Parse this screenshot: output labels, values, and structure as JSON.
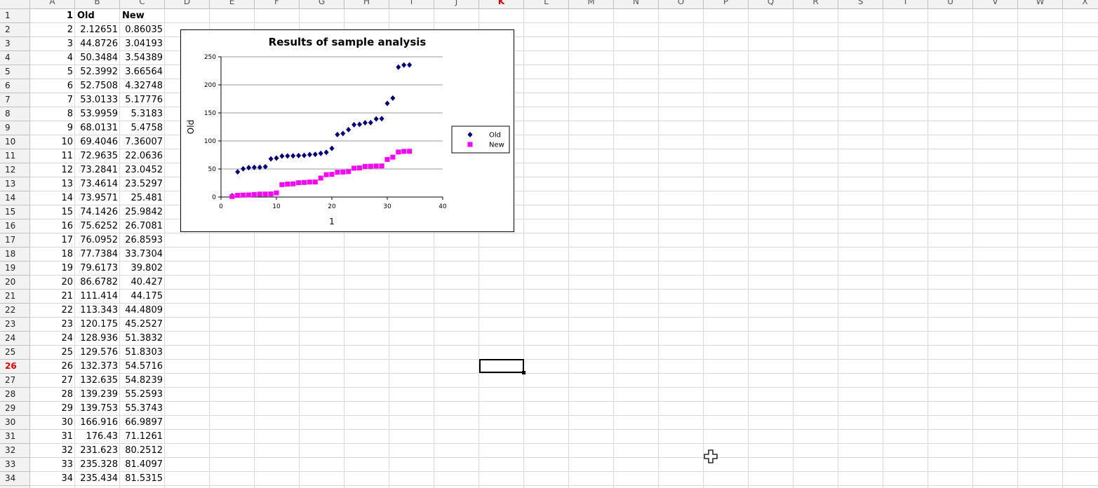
{
  "columns": [
    "A",
    "B",
    "C",
    "D",
    "E",
    "F",
    "G",
    "H",
    "I",
    "J",
    "K",
    "L",
    "M",
    "N",
    "O",
    "P",
    "Q",
    "R",
    "S",
    "T",
    "U",
    "V",
    "W",
    "X"
  ],
  "active_column": "K",
  "active_row": 26,
  "rows": [
    1,
    2,
    3,
    4,
    5,
    6,
    7,
    8,
    9,
    10,
    11,
    12,
    13,
    14,
    15,
    16,
    17,
    18,
    19,
    20,
    21,
    22,
    23,
    24,
    25,
    26,
    27,
    28,
    29,
    30,
    31,
    32,
    33,
    34
  ],
  "table": {
    "headers": {
      "A": "1",
      "B": "Old",
      "C": "New"
    },
    "data": [
      [
        "2",
        "2.12651",
        "0.86035"
      ],
      [
        "3",
        "44.8726",
        "3.04193"
      ],
      [
        "4",
        "50.3484",
        "3.54389"
      ],
      [
        "5",
        "52.3992",
        "3.66564"
      ],
      [
        "6",
        "52.7508",
        "4.32748"
      ],
      [
        "7",
        "53.0133",
        "5.17776"
      ],
      [
        "8",
        "53.9959",
        "5.3183"
      ],
      [
        "9",
        "68.0131",
        "5.4758"
      ],
      [
        "10",
        "69.4046",
        "7.36007"
      ],
      [
        "11",
        "72.9635",
        "22.0636"
      ],
      [
        "12",
        "73.2841",
        "23.0452"
      ],
      [
        "13",
        "73.4614",
        "23.5297"
      ],
      [
        "14",
        "73.9571",
        "25.481"
      ],
      [
        "15",
        "74.1426",
        "25.9842"
      ],
      [
        "16",
        "75.6252",
        "26.7081"
      ],
      [
        "17",
        "76.0952",
        "26.8593"
      ],
      [
        "18",
        "77.7384",
        "33.7304"
      ],
      [
        "19",
        "79.6173",
        "39.802"
      ],
      [
        "20",
        "86.6782",
        "40.427"
      ],
      [
        "21",
        "111.414",
        "44.175"
      ],
      [
        "22",
        "113.343",
        "44.4809"
      ],
      [
        "23",
        "120.175",
        "45.2527"
      ],
      [
        "24",
        "128.936",
        "51.3832"
      ],
      [
        "25",
        "129.576",
        "51.8303"
      ],
      [
        "26",
        "132.373",
        "54.5716"
      ],
      [
        "27",
        "132.635",
        "54.8239"
      ],
      [
        "28",
        "139.239",
        "55.2593"
      ],
      [
        "29",
        "139.753",
        "55.3743"
      ],
      [
        "30",
        "166.916",
        "66.9897"
      ],
      [
        "31",
        "176.43",
        "71.1261"
      ],
      [
        "32",
        "231.623",
        "80.2512"
      ],
      [
        "33",
        "235.328",
        "81.4097"
      ],
      [
        "34",
        "235.434",
        "81.5315"
      ]
    ]
  },
  "colors": {
    "old": "#000080",
    "new": "#ff00ff",
    "active_header": "#e00000"
  },
  "chart_data": {
    "type": "scatter",
    "title": "Results of sample analysis",
    "xlabel": "1",
    "ylabel": "Old",
    "xlim": [
      0,
      40
    ],
    "ylim": [
      0,
      250
    ],
    "xticks": [
      0,
      10,
      20,
      30,
      40
    ],
    "yticks": [
      0,
      50,
      100,
      150,
      200,
      250
    ],
    "grid": "horizontal",
    "legend_position": "right",
    "series": [
      {
        "name": "Old",
        "marker": "diamond",
        "color": "#000080",
        "x": [
          2,
          3,
          4,
          5,
          6,
          7,
          8,
          9,
          10,
          11,
          12,
          13,
          14,
          15,
          16,
          17,
          18,
          19,
          20,
          21,
          22,
          23,
          24,
          25,
          26,
          27,
          28,
          29,
          30,
          31,
          32,
          33,
          34
        ],
        "y": [
          2.12651,
          44.8726,
          50.3484,
          52.3992,
          52.7508,
          53.0133,
          53.9959,
          68.0131,
          69.4046,
          72.9635,
          73.2841,
          73.4614,
          73.9571,
          74.1426,
          75.6252,
          76.0952,
          77.7384,
          79.6173,
          86.6782,
          111.414,
          113.343,
          120.175,
          128.936,
          129.576,
          132.373,
          132.635,
          139.239,
          139.753,
          166.916,
          176.43,
          231.623,
          235.328,
          235.434
        ]
      },
      {
        "name": "New",
        "marker": "square",
        "color": "#ff00ff",
        "x": [
          2,
          3,
          4,
          5,
          6,
          7,
          8,
          9,
          10,
          11,
          12,
          13,
          14,
          15,
          16,
          17,
          18,
          19,
          20,
          21,
          22,
          23,
          24,
          25,
          26,
          27,
          28,
          29,
          30,
          31,
          32,
          33,
          34
        ],
        "y": [
          0.86035,
          3.04193,
          3.54389,
          3.66564,
          4.32748,
          5.17776,
          5.3183,
          5.4758,
          7.36007,
          22.0636,
          23.0452,
          23.5297,
          25.481,
          25.9842,
          26.7081,
          26.8593,
          33.7304,
          39.802,
          40.427,
          44.175,
          44.4809,
          45.2527,
          51.3832,
          51.8303,
          54.5716,
          54.8239,
          55.2593,
          55.3743,
          66.9897,
          71.1261,
          80.2512,
          81.4097,
          81.5315
        ]
      }
    ]
  }
}
